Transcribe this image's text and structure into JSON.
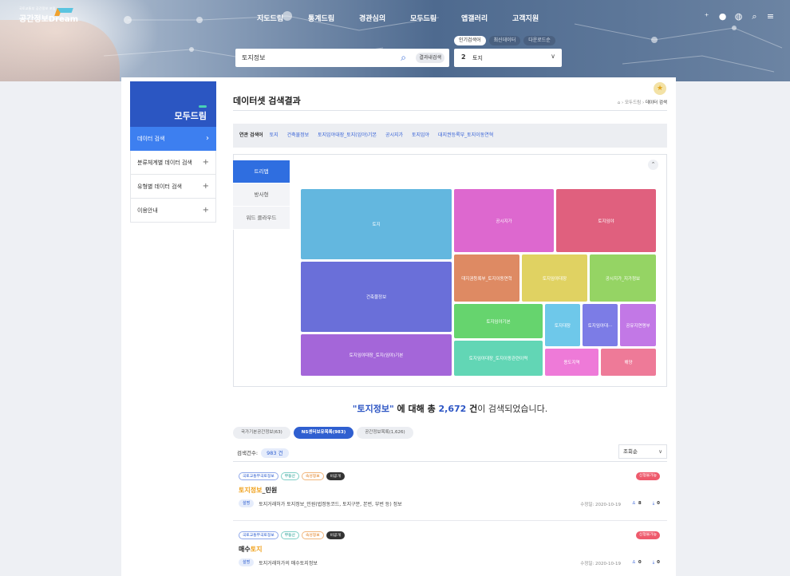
{
  "header": {
    "logo_sub": "국토교통부 공간정보 포털",
    "logo_main": "공간정보Dream",
    "nav": [
      "지도드림",
      "통계드림",
      "경관심의",
      "모두드림",
      "앱갤러리",
      "고객지원"
    ]
  },
  "search": {
    "value": "토지정보",
    "in_result_label": "결과내검색",
    "popular_tabs": [
      "인기검색어",
      "최신데이터",
      "다운로드순"
    ],
    "popular_rank": "2",
    "popular_word": "토지"
  },
  "sidebar": {
    "title": "모두드림",
    "items": [
      {
        "label": "데이터 검색"
      },
      {
        "label": "분류체계별 데이터 검색"
      },
      {
        "label": "유형별 데이터 검색"
      },
      {
        "label": "이용안내"
      }
    ]
  },
  "page": {
    "title": "데이터셋 검색결과",
    "breadcrumb": [
      "모두드림",
      "데이터 검색"
    ]
  },
  "related": {
    "label": "연관 검색어",
    "keywords": [
      "토지",
      "건축물정보",
      "토지임야대장_토지(임야)기본",
      "공시지가",
      "토지임야",
      "대지권등록부_토지이동연혁"
    ]
  },
  "viz": {
    "tabs": [
      "트리맵",
      "방사형",
      "워드 클라우드"
    ],
    "tiles": [
      {
        "label": "토지",
        "color": "#63b7df"
      },
      {
        "label": "공시지가",
        "color": "#dd68cf"
      },
      {
        "label": "토지임야",
        "color": "#e0607e"
      },
      {
        "label": "건축물정보",
        "color": "#6a6fd9"
      },
      {
        "label": "대지권등록부_토지이동연혁",
        "color": "#de8a63"
      },
      {
        "label": "토지임야대장",
        "color": "#e0d262"
      },
      {
        "label": "공시지가_지가정보",
        "color": "#95d464"
      },
      {
        "label": "토지임야기본",
        "color": "#66d46e"
      },
      {
        "label": "토지대장",
        "color": "#6ec8ea"
      },
      {
        "label": "토지임야대···",
        "color": "#7c7ce6"
      },
      {
        "label": "공유지연명부",
        "color": "#c278e6"
      },
      {
        "label": "토지임야대장_토지(임야)기본",
        "color": "#a466d9"
      },
      {
        "label": "토지임야대장_토지이동관련이력",
        "color": "#62d6b5"
      },
      {
        "label": "용도지역",
        "color": "#ee7ad8"
      },
      {
        "label": "해양",
        "color": "#ee7a98"
      }
    ]
  },
  "summary": {
    "query": "\"토지정보\"",
    "mid": " 에 대해 총 ",
    "count": "2,672",
    "unit": " 건",
    "tail": "이 검색되었습니다."
  },
  "source_tabs": [
    "국가기본공간정보(63)",
    "NS센터보유목록(983)",
    "공간정보목록(1,626)"
  ],
  "count_label": "검색건수:",
  "count_value": "983 건",
  "sort_label": "조회순",
  "results": [
    {
      "tags": [
        "국토교통부국토정보",
        "부동산",
        "속성정보",
        "비공개"
      ],
      "badge": "신청불가능",
      "title_hl": "토지정보",
      "title_rest": "_민원",
      "desc_label": "설명",
      "desc": "토지거래허가 토지정보_민원(법정동코드, 토지구분, 본번, 부번 등) 정보",
      "date": "수정일: 2020-10-19",
      "views": "8",
      "downloads": "0"
    },
    {
      "tags": [
        "국토교통부국토정보",
        "부동산",
        "속성정보",
        "비공개"
      ],
      "badge": "신청불가능",
      "title_pre": "매수",
      "title_hl": "토지",
      "desc_label": "설명",
      "desc": "토지거래허가의 매수토지정보",
      "date": "수정일: 2020-10-19",
      "views": "0",
      "downloads": "0"
    }
  ]
}
